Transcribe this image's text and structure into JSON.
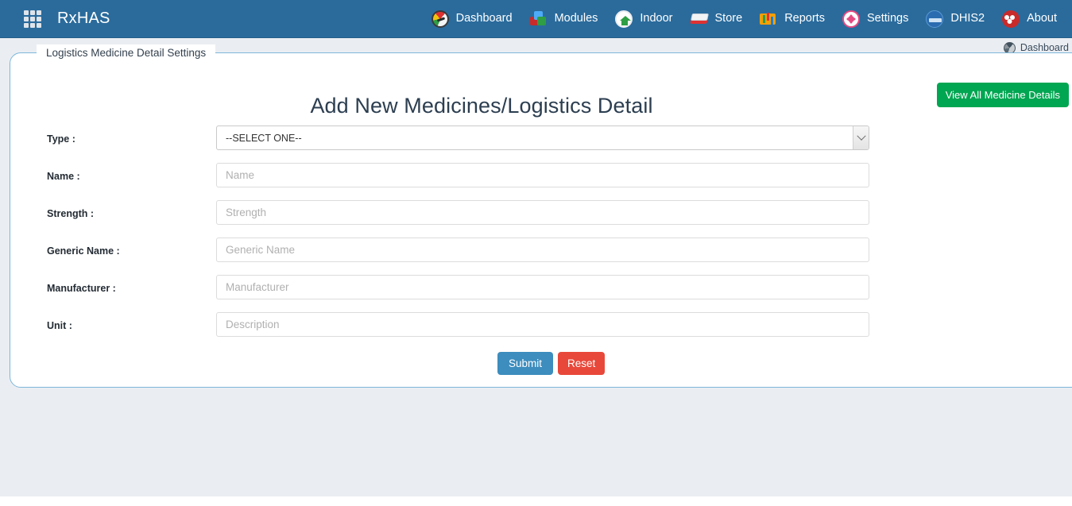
{
  "navbar": {
    "apps_icon": "apps-grid-icon",
    "brand": "RxHAS",
    "items": [
      {
        "label": "Dashboard",
        "icon": "dashboard-gauge-icon"
      },
      {
        "label": "Modules",
        "icon": "modules-blocks-icon"
      },
      {
        "label": "Indoor",
        "icon": "indoor-house-icon"
      },
      {
        "label": "Store",
        "icon": "store-box-icon"
      },
      {
        "label": "Reports",
        "icon": "reports-chart-icon"
      },
      {
        "label": "Settings",
        "icon": "settings-gear-icon"
      },
      {
        "label": "DHIS2",
        "icon": "dhis2-logo-icon"
      },
      {
        "label": "About",
        "icon": "about-people-icon"
      }
    ]
  },
  "breadcrumb": {
    "icon": "dashboard-gauge-icon",
    "label": "Dashboard"
  },
  "panel": {
    "legend": "Logistics Medicine Detail Settings",
    "view_all_button": "View All Medicine Details",
    "title": "Add New Medicines/Logistics Detail"
  },
  "form": {
    "fields": [
      {
        "label": "Type :",
        "type": "select",
        "value": "--SELECT ONE--",
        "name": "type"
      },
      {
        "label": "Name :",
        "type": "text",
        "placeholder": "Name",
        "value": "",
        "name": "name"
      },
      {
        "label": "Strength :",
        "type": "text",
        "placeholder": "Strength",
        "value": "",
        "name": "strength"
      },
      {
        "label": "Generic Name :",
        "type": "text",
        "placeholder": "Generic Name",
        "value": "",
        "name": "generic-name"
      },
      {
        "label": "Manufacturer :",
        "type": "text",
        "placeholder": "Manufacturer",
        "value": "",
        "name": "manufacturer"
      },
      {
        "label": "Unit :",
        "type": "text",
        "placeholder": "Description",
        "value": "",
        "name": "unit"
      }
    ],
    "submit_label": "Submit",
    "reset_label": "Reset"
  },
  "colors": {
    "navbar": "#2a6b9c",
    "panel_border": "#7eb6d9",
    "page_background": "#eaeef3",
    "view_all_button": "#00a651",
    "submit_button": "#3d8dbe",
    "reset_button": "#e8483a"
  }
}
